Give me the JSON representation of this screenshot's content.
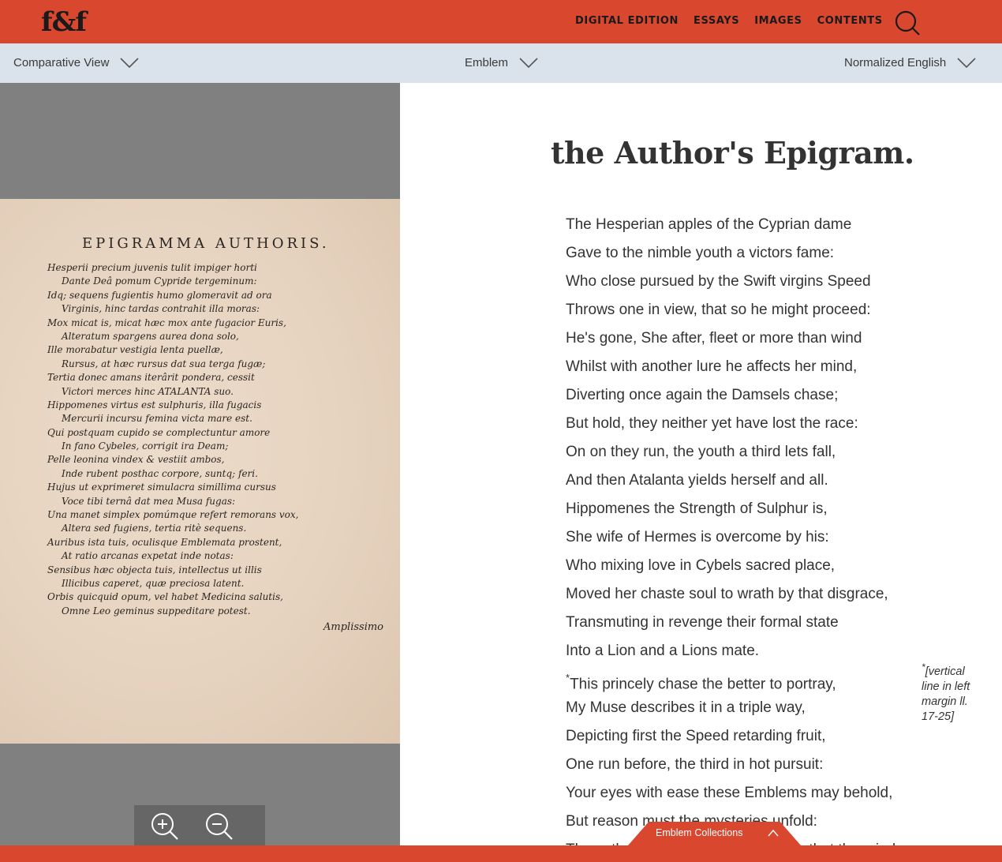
{
  "header": {
    "logo": "f&f",
    "nav": [
      "DIGITAL EDITION",
      "ESSAYS",
      "IMAGES",
      "CONTENTS"
    ]
  },
  "toolbar": {
    "view": "Comparative View",
    "section": "Emblem",
    "language": "Normalized English"
  },
  "scan": {
    "heading": "EPIGRAMMA AUTHORIS.",
    "lines": [
      "Hesperii precium juvenis tulit impiger horti",
      "Dante Deâ pomum Cypride tergeminum:",
      "Idq; sequens fugientis humo glomeravit ad ora",
      "Virginis, hinc tardas contrahit illa moras:",
      "Mox micat is, micat hæc mox ante fugacior Euris,",
      "Alteratum spargens aurea dona solo,",
      "Ille morabatur vestigia lenta puellæ,",
      "Rursus, at hæc rursus dat sua terga fugæ;",
      "Tertia donec amans iterârit pondera, cessit",
      "Victori merces hinc ATALANTA suo.",
      "Hippomenes virtus est sulphuris, illa fugacis",
      "Mercurii incursu femina victa mare est.",
      "Qui postquam cupido se complectuntur amore",
      "In fano Cybeles, corrigit ira Deam;",
      "Pelle leonina vindex & vestiit ambos,",
      "Inde rubent posthac corpore, suntq; feri.",
      "Hujus ut exprimeret simulacra simillima cursus",
      "Voce tibi ternâ dat mea Musa fugas:",
      "Una manet simplex pomúmque refert remorans vox,",
      "Altera sed fugiens, tertia ritè sequens.",
      "Auribus ista tuis, oculisque Emblemata prostent,",
      "At ratio arcanas expetat inde notas:",
      "Sensibus hæc objecta tuis, intellectus ut illis",
      "Illicibus caperet, quæ preciosa latent.",
      "Orbis quicquid opum, vel habet Medicina salutis,",
      "Omne Leo geminus suppeditare potest."
    ],
    "catchword": "Amplissimo"
  },
  "content": {
    "title": "the Author's Epigram.",
    "lines": [
      "The Hesperian apples of the Cyprian dame",
      "Gave to the nimble youth a victors fame:",
      "Who close pursued by the Swift virgins Speed",
      "Throws one in view, that so he might proceed:",
      "He's gone, She after, fleet or more than wind",
      "Whilst with another lure he affects her mind,",
      "Diverting once again the Damsels chase;",
      "But hold, they neither yet have lost the race:",
      "On on they run, the youth a third lets fall,",
      "And then Atalanta yields herself and all.",
      "Hippomenes the Strength of Sulphur is,",
      "She wife of Hermes is overcome by his:",
      "Who mixing love in Cybels sacred place,",
      "Moved her chaste soul to wrath by that disgrace,",
      "Transmuting in revenge their formal state",
      "Into a Lion and a Lions mate.",
      "This princely chase the better to portray,",
      "My Muse describes it in a triple way,",
      "Depicting first the Speed retarding fruit,",
      "One run before, the third in hot pursuit:",
      "Your eyes with ease these Emblems may behold,",
      "But reason must the mysteries unfold:",
      "These thus presented to your sense that the mind"
    ],
    "note_marker": "*",
    "note": "[vertical line in left margin ll. 17-25]"
  },
  "footer": {
    "collections": "Emblem Collections"
  }
}
